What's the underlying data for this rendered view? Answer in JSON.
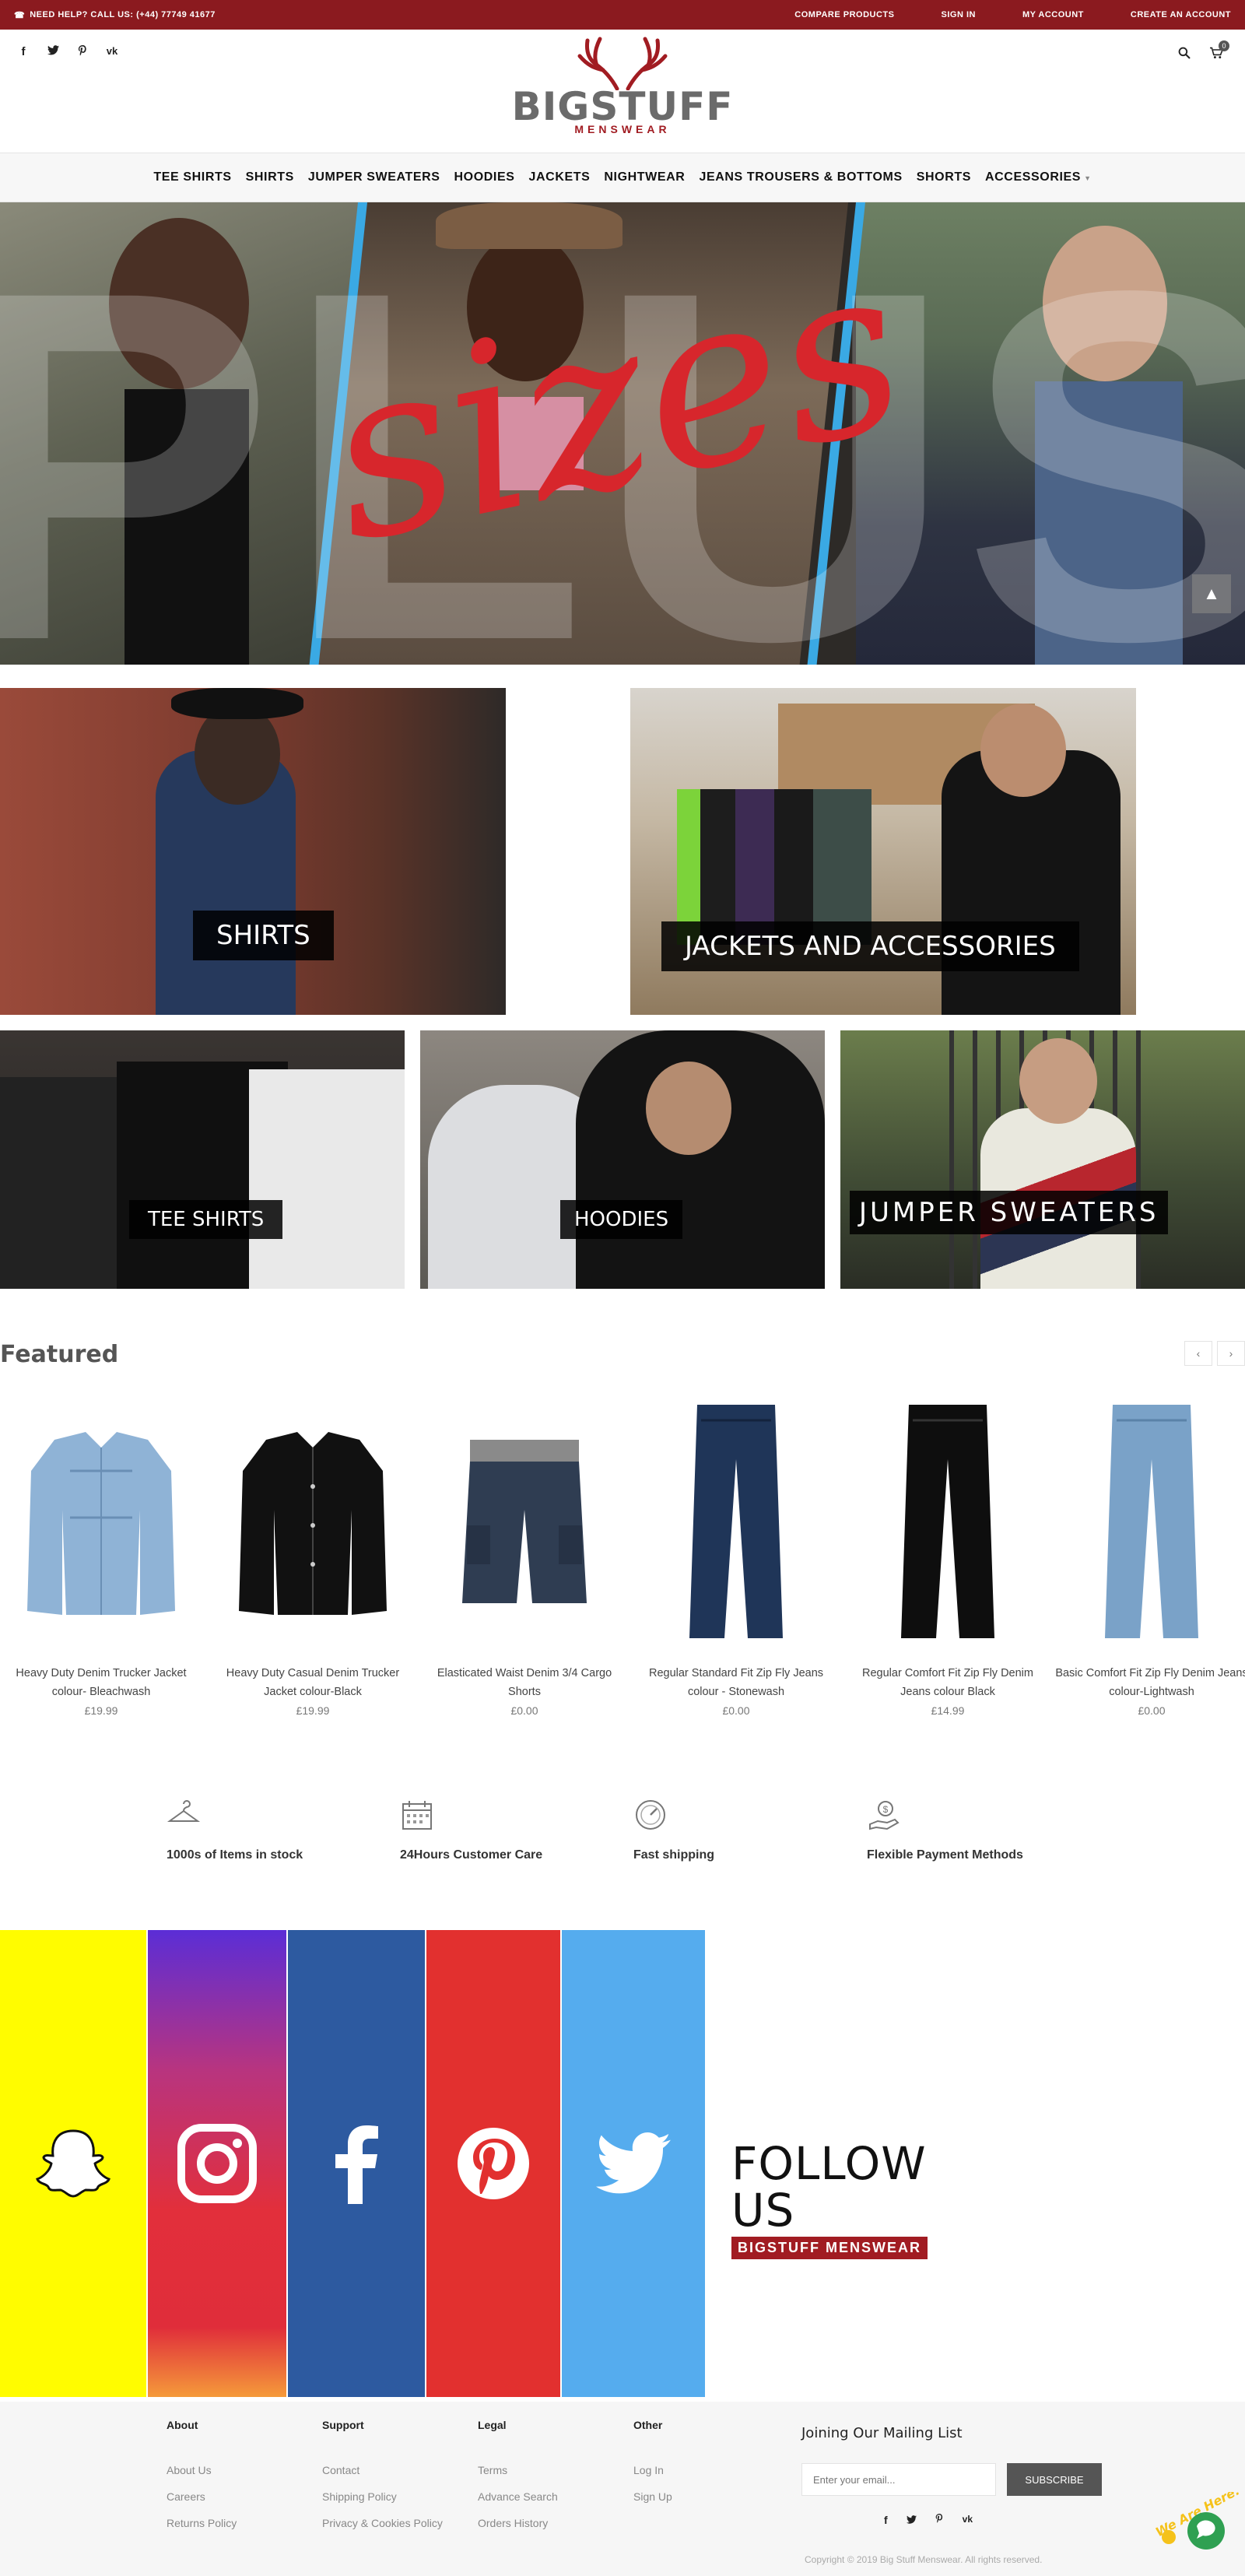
{
  "topbar": {
    "help": "NEED HELP? CALL US: (+44) 77749 41677",
    "links": [
      "COMPARE PRODUCTS",
      "SIGN IN",
      "MY ACCOUNT",
      "CREATE AN ACCOUNT"
    ]
  },
  "header": {
    "brand": "BIGSTUFF",
    "brand_sub": "MENSWEAR",
    "social_icons": [
      "facebook-icon",
      "twitter-icon",
      "pinterest-icon",
      "vk-icon"
    ],
    "cart_count": "0"
  },
  "nav": {
    "items": [
      "TEE SHIRTS",
      "SHIRTS",
      "JUMPER SWEATERS",
      "HOODIES",
      "JACKETS",
      "NIGHTWEAR",
      "JEANS TROUSERS & BOTTOMS",
      "SHORTS",
      "ACCESSORIES"
    ]
  },
  "hero": {
    "word_back": "PLUS",
    "word_front": "sizes"
  },
  "categories": {
    "shirts": "SHIRTS",
    "jackets": "JACKETS AND ACCESSORIES",
    "tees": "TEE SHIRTS",
    "hoodies": "HOODIES",
    "jumpers": "JUMPER SWEATERS"
  },
  "featured": {
    "title": "Featured",
    "prev": "‹",
    "next": "›",
    "products": [
      {
        "name": "Heavy Duty Denim Trucker Jacket colour- Bleachwash",
        "price": "£19.99"
      },
      {
        "name": "Heavy Duty Casual Denim Trucker Jacket colour-Black",
        "price": "£19.99"
      },
      {
        "name": "Elasticated Waist Denim 3/4 Cargo Shorts",
        "price": "£0.00"
      },
      {
        "name": "Regular Standard Fit Zip Fly Jeans colour - Stonewash",
        "price": "£0.00"
      },
      {
        "name": "Regular Comfort Fit Zip Fly Denim Jeans colour Black",
        "price": "£14.99"
      },
      {
        "name": "Basic Comfort Fit Zip Fly Denim Jeans colour-Lightwash",
        "price": "£0.00"
      }
    ]
  },
  "features": [
    {
      "icon": "hanger-icon",
      "text": "1000s of Items in stock"
    },
    {
      "icon": "calendar-icon",
      "text": "24Hours Customer Care"
    },
    {
      "icon": "speed-icon",
      "text": "Fast shipping"
    },
    {
      "icon": "money-hand-icon",
      "text": "Flexible Payment Methods"
    }
  ],
  "follow": {
    "title": "FOLLOW US",
    "subtitle": "BIGSTUFF MENSWEAR",
    "networks": [
      {
        "icon": "snapchat-icon",
        "color": "#fffc00"
      },
      {
        "icon": "instagram-icon",
        "color": "#c13584"
      },
      {
        "icon": "facebook-icon",
        "color": "#2d5aa0"
      },
      {
        "icon": "pinterest-icon",
        "color": "#e2302f"
      },
      {
        "icon": "twitter-icon",
        "color": "#55acee"
      }
    ]
  },
  "footer": {
    "columns": [
      {
        "title": "About",
        "links": [
          "About Us",
          "Careers",
          "Returns Policy"
        ]
      },
      {
        "title": "Support",
        "links": [
          "Contact",
          "Shipping Policy",
          "Privacy & Cookies Policy"
        ]
      },
      {
        "title": "Legal",
        "links": [
          "Terms",
          "Advance Search",
          "Orders History"
        ]
      },
      {
        "title": "Other",
        "links": [
          "Log In",
          "Sign Up"
        ]
      }
    ],
    "mailing_title": "Joining Our Mailing List",
    "email_placeholder": "Enter your email...",
    "subscribe": "SUBSCRIBE",
    "copyright": "Copyright © 2019 Big Stuff Menswear. All rights reserved.",
    "chat_label": "We Are Here!"
  },
  "colors": {
    "brand_red": "#8b1a1f",
    "accent_red": "#d7262c",
    "hero_blue": "#3aa9e4"
  }
}
